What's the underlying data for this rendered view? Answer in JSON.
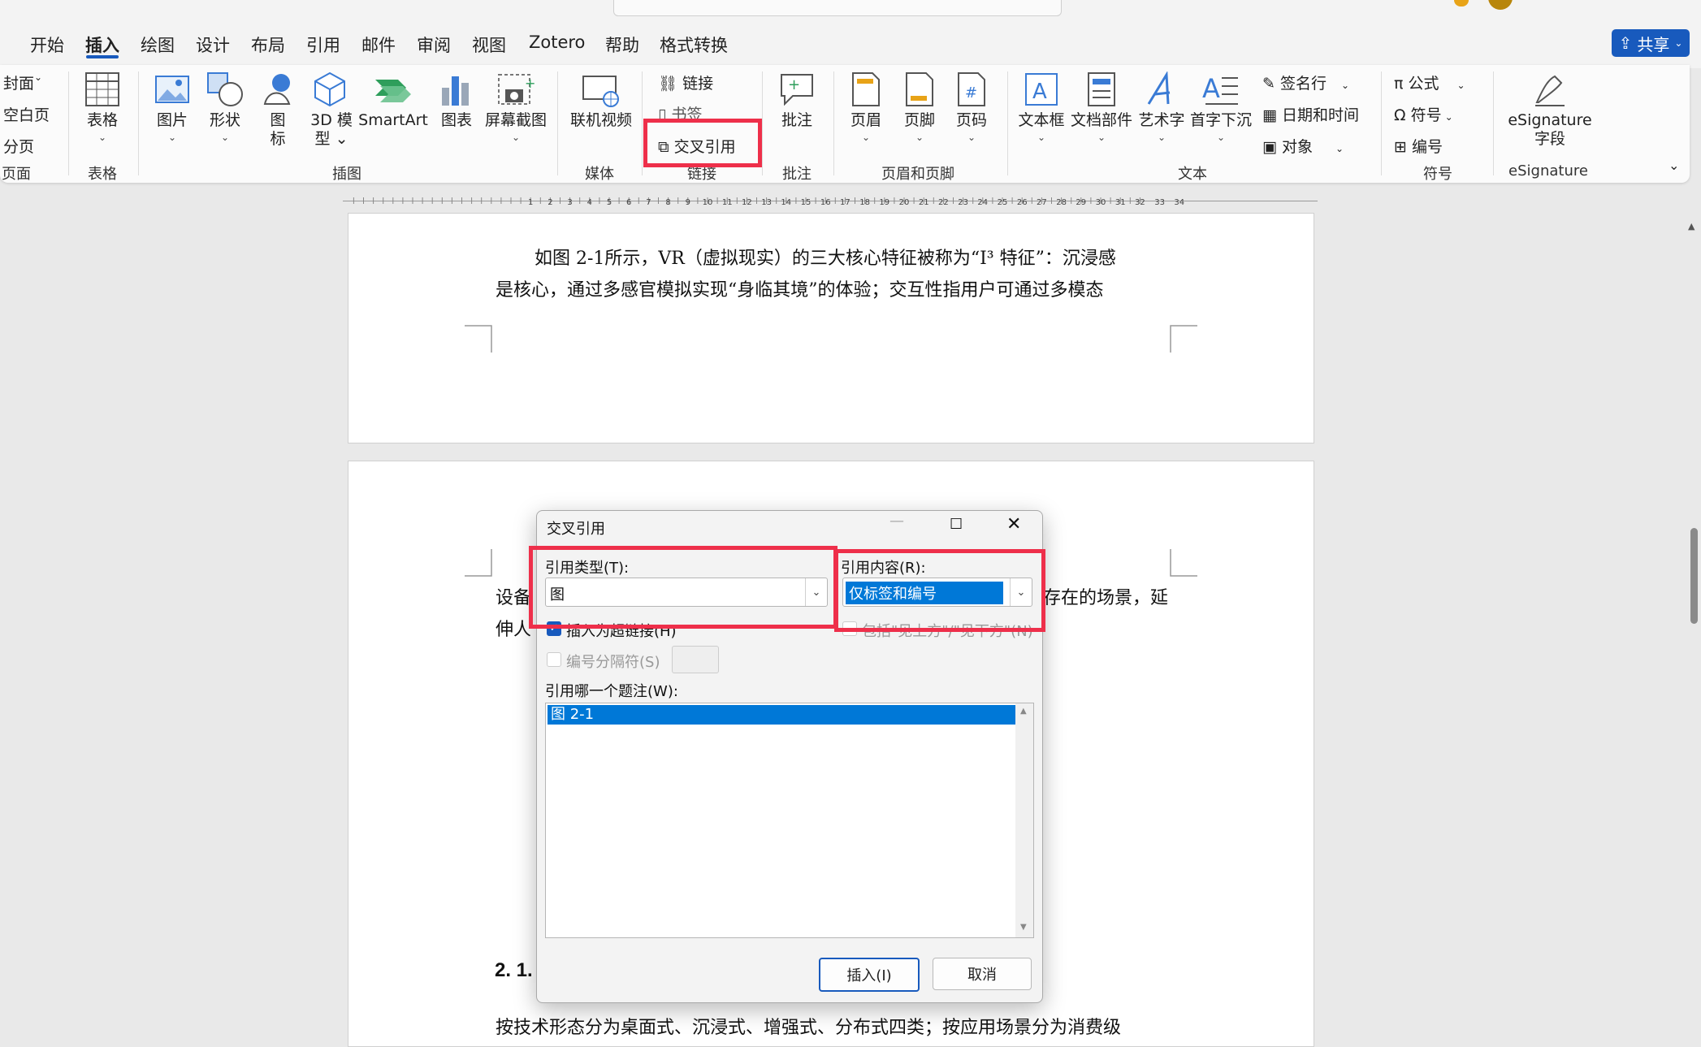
{
  "tabs": [
    "开始",
    "插入",
    "绘图",
    "设计",
    "布局",
    "引用",
    "邮件",
    "审阅",
    "视图",
    "Zotero",
    "帮助",
    "格式转换"
  ],
  "share_label": "共享",
  "ribbon": {
    "pages": {
      "cover": "封面",
      "blank": "空白页",
      "break": "分页",
      "label": "页面"
    },
    "table": {
      "button": "表格",
      "label": "表格"
    },
    "illustrations": {
      "picture": "图片",
      "shapes": "形状",
      "icon1": "图",
      "icon2": "标",
      "model1": "3D 模",
      "model2": "型",
      "smartart": "SmartArt",
      "chart": "图表",
      "screenshot": "屏幕截图",
      "label": "插图"
    },
    "media": {
      "video": "联机视频",
      "label": "媒体"
    },
    "links": {
      "link": "链接",
      "bookmark": "书签",
      "crossref": "交叉引用",
      "label": "链接"
    },
    "comments": {
      "comment": "批注",
      "label": "批注"
    },
    "header_footer": {
      "header": "页眉",
      "footer": "页脚",
      "page_number": "页码",
      "label": "页眉和页脚"
    },
    "text": {
      "textbox": "文本框",
      "parts": "文档部件",
      "wordart": "艺术字",
      "dropcap": "首字下沉",
      "signature_line": "签名行",
      "datetime": "日期和时间",
      "object": "对象",
      "label": "文本"
    },
    "symbols": {
      "equation": "公式",
      "symbol": "符号",
      "number": "编号",
      "label": "符号"
    },
    "esig": {
      "button1": "eSignature",
      "button2": "字段",
      "label": "eSignature"
    }
  },
  "ruler_numbers": [
    "1",
    "2",
    "3",
    "4",
    "5",
    "6",
    "7",
    "8",
    "9",
    "10",
    "11",
    "12",
    "13",
    "14",
    "15",
    "16",
    "17",
    "18",
    "19",
    "20",
    "21",
    "22",
    "23",
    "24",
    "25",
    "26",
    "27",
    "28",
    "29",
    "30",
    "31",
    "32",
    "33",
    "34"
  ],
  "document": {
    "p1_line1": "如图 2-1所示，VR（虚拟现实）的三大核心特征被称为“I³ 特征”：沉浸感",
    "p1_line2": "是核心，通过多感官模拟实现“身临其境”的体验；交互性指用户可通过多模态",
    "p2_left1": "设备",
    "p2_right1": "存在的场景，延",
    "p2_left2": "伸人",
    "heading_fragment": "2. 1.",
    "p3_line1": "按技术形态分为桌面式、沉浸式、增强式、分布式四类；按应用场景分为消费级"
  },
  "dialog": {
    "title": "交叉引用",
    "ref_type_label": "引用类型(T):",
    "ref_type_value": "图",
    "ref_content_label": "引用内容(R):",
    "ref_content_value": "仅标签和编号",
    "insert_hyperlink": "插入为超链接(H)",
    "insert_hyperlink_checked": true,
    "include_above_below": "包括\"见上方\"/\"见下方\"(N)",
    "separate_numbers": "编号分隔符(S)",
    "which_caption_label": "引用哪一个题注(W):",
    "captions": [
      "图 2-1"
    ],
    "insert_button": "插入(I)",
    "cancel_button": "取消"
  },
  "colors": {
    "accent": "#185abd",
    "highlight_red": "#ee2f4a",
    "selection": "#0078d7"
  }
}
